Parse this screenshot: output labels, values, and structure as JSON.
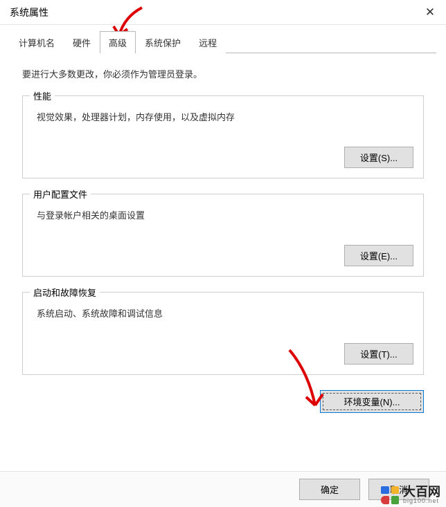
{
  "window": {
    "title": "系统属性",
    "close_glyph": "✕"
  },
  "tabs": [
    {
      "label": "计算机名"
    },
    {
      "label": "硬件"
    },
    {
      "label": "高级"
    },
    {
      "label": "系统保护"
    },
    {
      "label": "远程"
    }
  ],
  "active_tab_index": 2,
  "content": {
    "hint": "要进行大多数更改，你必须作为管理员登录。",
    "sections": [
      {
        "legend": "性能",
        "desc": "视觉效果，处理器计划，内存使用，以及虚拟内存",
        "button": "设置(S)..."
      },
      {
        "legend": "用户配置文件",
        "desc": "与登录帐户相关的桌面设置",
        "button": "设置(E)..."
      },
      {
        "legend": "启动和故障恢复",
        "desc": "系统启动、系统故障和调试信息",
        "button": "设置(T)..."
      }
    ],
    "env_button": "环境变量(N)..."
  },
  "footer": {
    "ok": "确定",
    "cancel": "取消"
  },
  "watermark": {
    "cn": "大百网",
    "en": "big100.net"
  }
}
